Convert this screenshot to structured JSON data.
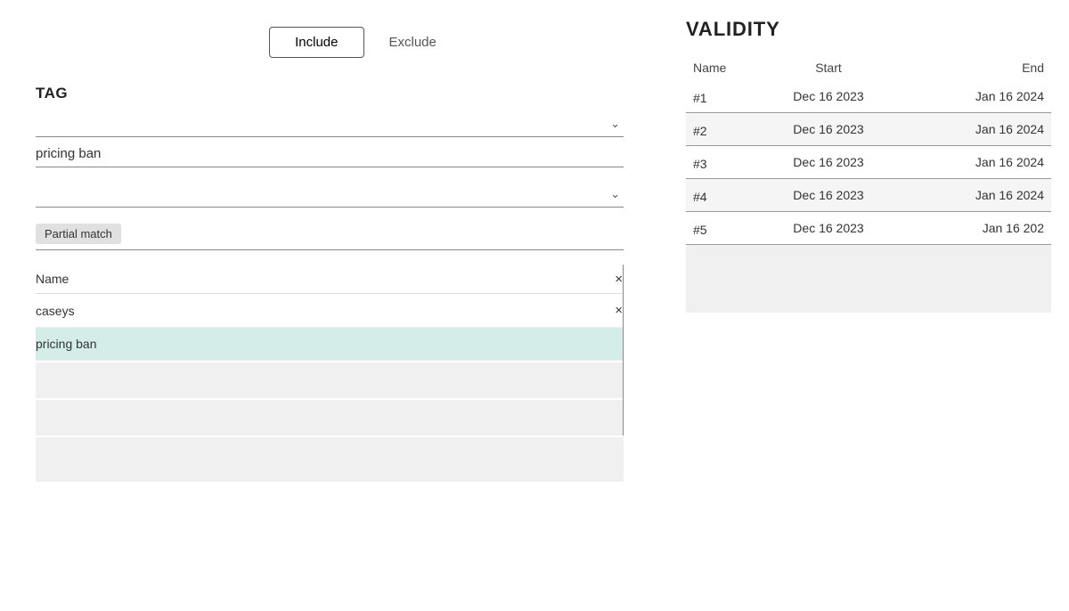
{
  "toggle": {
    "include_label": "Include",
    "exclude_label": "Exclude",
    "active": "include"
  },
  "left": {
    "tag_label": "TAG",
    "dropdown1_value": "",
    "field_value": "pricing ban",
    "dropdown2_value": "",
    "partial_match_label": "Partial match",
    "list": {
      "header_label": "Name",
      "close_icon": "×",
      "items": [
        {
          "text": "caseys",
          "highlighted": false,
          "show_x": true
        },
        {
          "text": "pricing ban",
          "highlighted": true,
          "show_x": false
        }
      ]
    }
  },
  "right": {
    "title": "VALIDITY",
    "table": {
      "headers": {
        "name": "Name",
        "start": "Start",
        "end": "End"
      },
      "rows": [
        {
          "id": "#1",
          "start": "Dec 16 2023",
          "end": "Jan 16 2024"
        },
        {
          "id": "#2",
          "start": "Dec 16 2023",
          "end": "Jan 16 2024"
        },
        {
          "id": "#3",
          "start": "Dec 16 2023",
          "end": "Jan 16 2024"
        },
        {
          "id": "#4",
          "start": "Dec 16 2023",
          "end": "Jan 16 2024"
        },
        {
          "id": "#5",
          "start": "Dec 16 2023",
          "end": "Jan 16 202"
        }
      ]
    }
  }
}
